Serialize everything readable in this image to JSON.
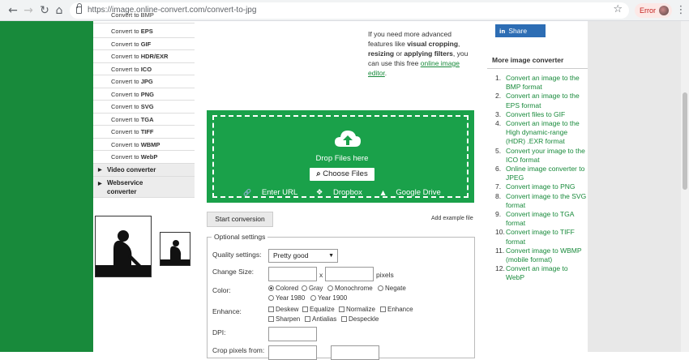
{
  "browser": {
    "back_icon": "←",
    "forward_icon": "→",
    "reload_icon": "↻",
    "home_icon": "⌂",
    "url_host": "https://image.online-convert.com",
    "url_path": "/convert-to-jpg",
    "star_icon": "☆",
    "error_label": "Error",
    "menu_icon": "⋮"
  },
  "sidebar": {
    "partial_item": "Convert to BMP",
    "items": [
      {
        "prefix": "Convert to ",
        "format": "EPS"
      },
      {
        "prefix": "Convert to ",
        "format": "GIF"
      },
      {
        "prefix": "Convert to ",
        "format": "HDR/EXR"
      },
      {
        "prefix": "Convert to ",
        "format": "ICO"
      },
      {
        "prefix": "Convert to ",
        "format": "JPG"
      },
      {
        "prefix": "Convert to ",
        "format": "PNG"
      },
      {
        "prefix": "Convert to ",
        "format": "SVG"
      },
      {
        "prefix": "Convert to ",
        "format": "TGA"
      },
      {
        "prefix": "Convert to ",
        "format": "TIFF"
      },
      {
        "prefix": "Convert to ",
        "format": "WBMP"
      },
      {
        "prefix": "Convert to ",
        "format": "WebP"
      }
    ],
    "groups": [
      "Video converter",
      "Webservice converter"
    ],
    "group_icon": "▶"
  },
  "info": {
    "line1": "If you need more advanced features like ",
    "bold1": "visual cropping",
    "sep1": ", ",
    "bold2": "resizing",
    "sep2": " or ",
    "bold3": "applying filters",
    "line2": ", you can use this free ",
    "link": "online image editor",
    "end": "."
  },
  "upload": {
    "drop_text": "Drop Files here",
    "choose_label": "Choose Files",
    "enter_url": "Enter URL",
    "dropbox": "Dropbox",
    "google_drive": "Google Drive",
    "search_icon": "⌕",
    "link_icon": "🔗",
    "dropbox_icon": "❖",
    "drive_icon": "▲"
  },
  "actions": {
    "start_label": "Start conversion",
    "add_example": "Add example file"
  },
  "options": {
    "legend": "Optional settings",
    "quality_label": "Quality settings:",
    "quality_value": "Pretty good",
    "caret": "▼",
    "size_label": "Change Size:",
    "size_x": "x",
    "size_unit": "pixels",
    "color_label": "Color:",
    "colors": [
      "Colored",
      "Gray",
      "Monochrome",
      "Negate",
      "Year 1980",
      "Year 1900"
    ],
    "enhance_label": "Enhance:",
    "enhance": [
      "Deskew",
      "Equalize",
      "Normalize",
      "Enhance",
      "Sharpen",
      "Antialias",
      "Despeckle"
    ],
    "dpi_label": "DPI:",
    "crop_label": "Crop pixels from:"
  },
  "share": {
    "icon": "in",
    "label": "Share"
  },
  "related": {
    "title": "More image converter",
    "items": [
      "Convert an image to the BMP format",
      "Convert an image to the EPS format",
      "Convert files to GIF",
      "Convert an image to the High dynamic-range (HDR) .EXR format",
      "Convert your image to the ICO format",
      "Online image converter to JPEG",
      "Convert image to PNG",
      "Convert image to the SVG format",
      "Convert image to TGA format",
      "Convert image to TIFF format",
      "Convert image to WBMP (mobile format)",
      "Convert an image to WebP"
    ]
  }
}
